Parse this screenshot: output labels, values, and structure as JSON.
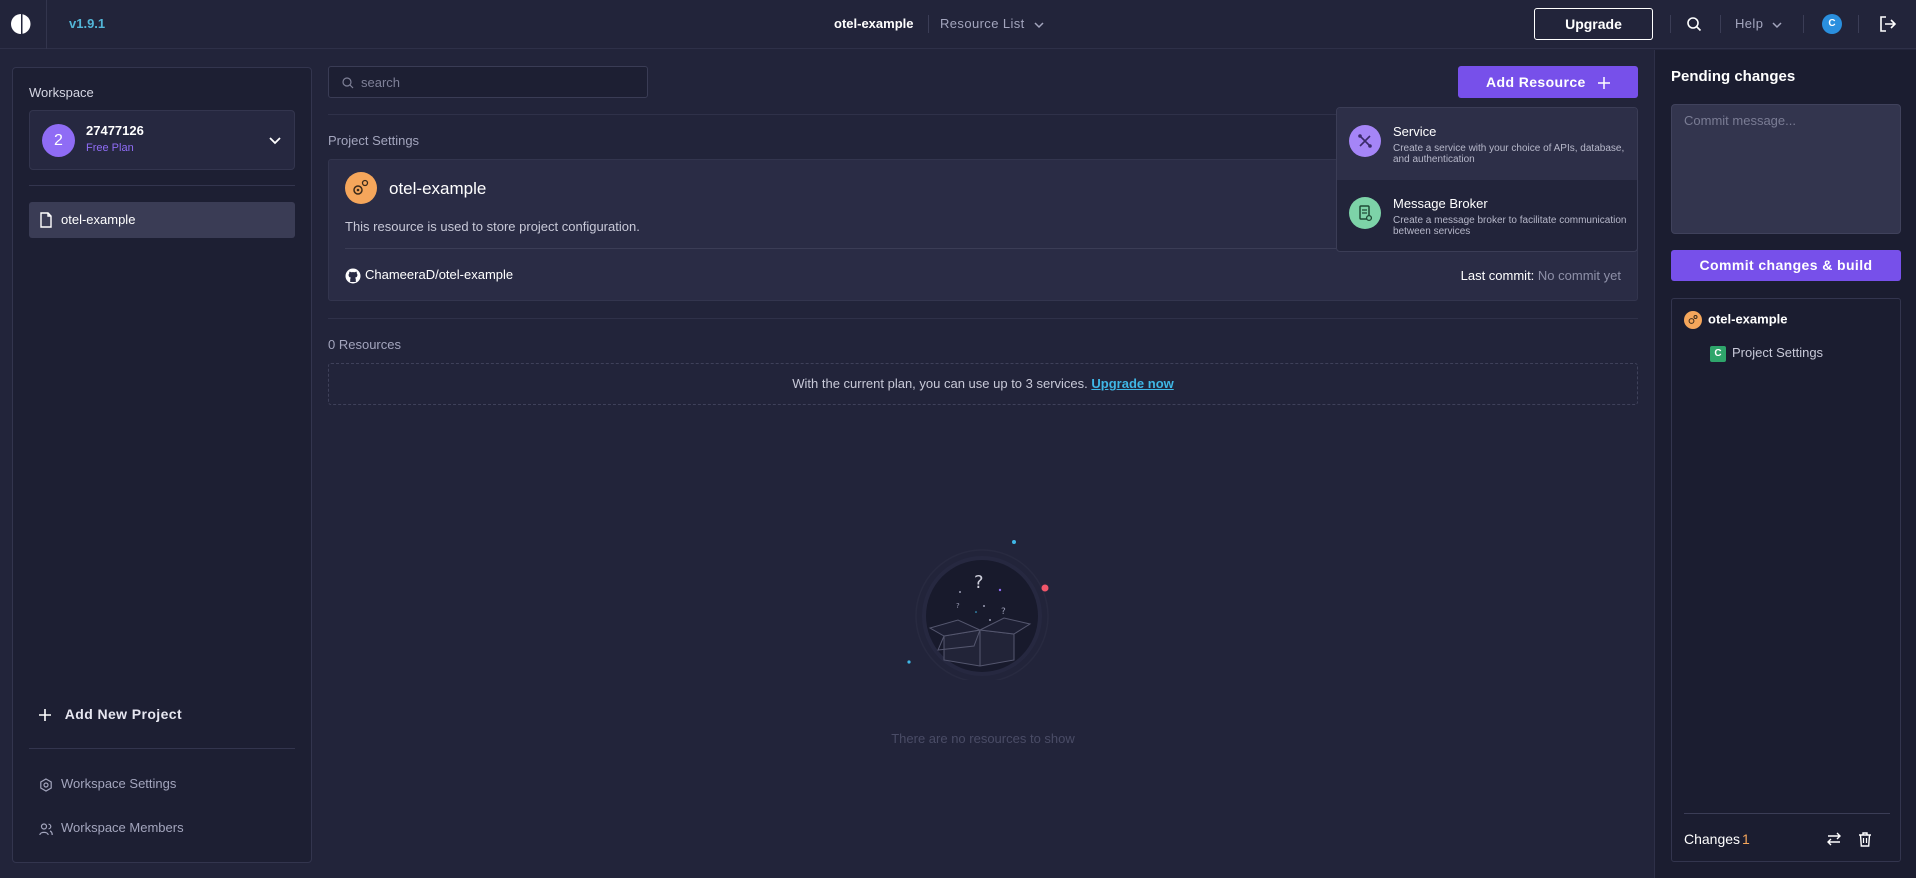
{
  "header": {
    "version": "v1.9.1",
    "project_title": "otel-example",
    "resource_list_label": "Resource List",
    "upgrade_label": "Upgrade",
    "help_label": "Help",
    "user_initial": "C"
  },
  "sidebar": {
    "workspace_label": "Workspace",
    "workspace_avatar": "2",
    "workspace_name": "27477126",
    "workspace_plan": "Free Plan",
    "projects": [
      {
        "label": "otel-example"
      }
    ],
    "add_project_label": "Add New Project",
    "settings_label": "Workspace Settings",
    "members_label": "Workspace Members"
  },
  "main": {
    "search_placeholder": "search",
    "add_resource_label": "Add Resource",
    "project_settings_label": "Project Settings",
    "project_card": {
      "title": "otel-example",
      "description": "This resource is used to store project configuration.",
      "repo": "ChameeraD/otel-example",
      "last_commit_label": "Last commit:",
      "last_commit_value": "No commit yet"
    },
    "resources_count_label": "0 Resources",
    "limit_text": "With the current plan, you can use up to 3 services.",
    "limit_link": "Upgrade now",
    "empty_text": "There are no resources to show"
  },
  "dropdown": {
    "items": [
      {
        "title": "Service",
        "description": "Create a service with your choice of APIs, database, and authentication",
        "icon": "service-icon",
        "color": "#a585f7"
      },
      {
        "title": "Message Broker",
        "description": "Create a message broker to facilitate communication between services",
        "icon": "message-broker-icon",
        "color": "#7dd3a8"
      }
    ]
  },
  "pending": {
    "title": "Pending changes",
    "commit_placeholder": "Commit message...",
    "commit_button": "Commit changes & build",
    "project_name": "otel-example",
    "change_item_badge": "C",
    "change_item_label": "Project Settings",
    "changes_label": "Changes",
    "changes_count": "1"
  },
  "colors": {
    "accent": "#7750ea",
    "background": "#22243a",
    "link": "#3fb7e6",
    "project_badge": "#f5a65b"
  }
}
